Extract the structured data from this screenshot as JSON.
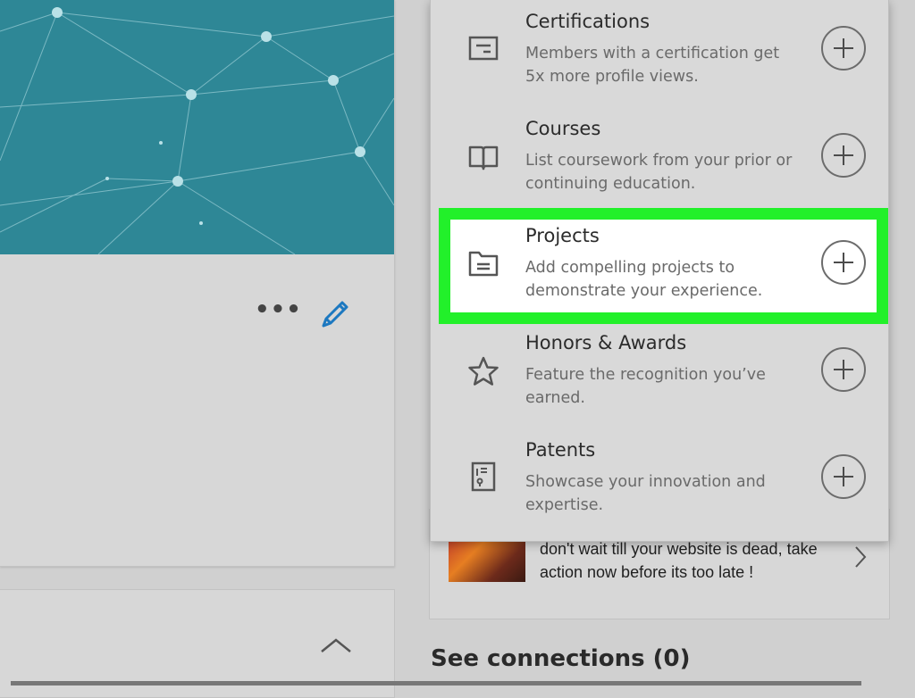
{
  "profile": {
    "more_label": "•••"
  },
  "add_section_menu": {
    "items": [
      {
        "title": "Certifications",
        "description": "Members with a certification get 5x more profile views.",
        "icon": "certificate-icon"
      },
      {
        "title": "Courses",
        "description": "List coursework from your prior or continuing education.",
        "icon": "book-icon"
      },
      {
        "title": "Projects",
        "description": "Add compelling projects to demonstrate your experience.",
        "icon": "folder-icon",
        "highlighted": true
      },
      {
        "title": "Honors & Awards",
        "description": "Feature the recognition you’ve earned.",
        "icon": "star-icon"
      },
      {
        "title": "Patents",
        "description": "Showcase your innovation and expertise.",
        "icon": "patent-icon"
      }
    ]
  },
  "ad": {
    "text": "don't wait till your website is dead, take action now before its too late !"
  },
  "connections": {
    "label": "See connections (0)"
  },
  "colors": {
    "highlight": "#22f02a",
    "banner": "#2e8796",
    "edit_icon": "#1c78c0"
  }
}
